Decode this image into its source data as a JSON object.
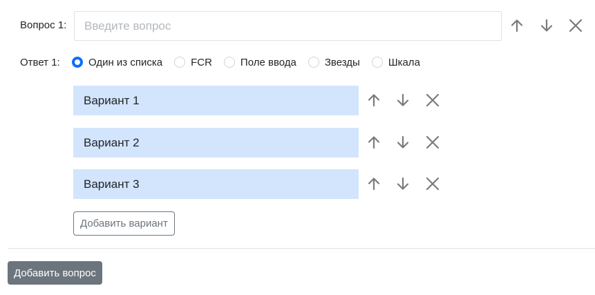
{
  "question": {
    "label": "Вопрос 1:",
    "placeholder": "Введите вопрос",
    "value": ""
  },
  "answer": {
    "label": "Ответ 1:",
    "types": [
      {
        "label": "Один из списка",
        "checked": true
      },
      {
        "label": "FCR",
        "checked": false
      },
      {
        "label": "Поле ввода",
        "checked": false
      },
      {
        "label": "Звезды",
        "checked": false
      },
      {
        "label": "Шкала",
        "checked": false
      }
    ]
  },
  "options": [
    {
      "label": "Вариант 1"
    },
    {
      "label": "Вариант 2"
    },
    {
      "label": "Вариант 3"
    }
  ],
  "buttons": {
    "add_option": "Добавить вариант",
    "add_question": "Добавить вопрос"
  },
  "colors": {
    "accent": "#0d6efd",
    "option_bg": "#d3e4fd",
    "secondary": "#6c757d",
    "icon": "#7a7a7a"
  },
  "icons": {
    "up": "arrow-up-icon",
    "down": "arrow-down-icon",
    "remove": "close-icon"
  }
}
